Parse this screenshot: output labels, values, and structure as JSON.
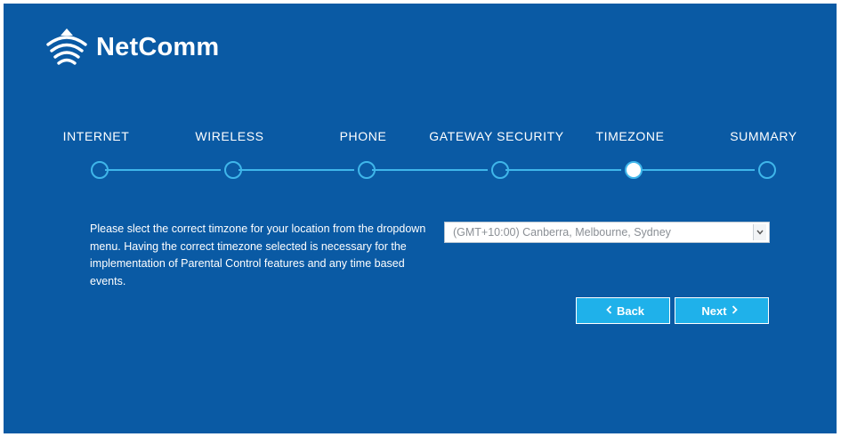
{
  "brand": {
    "name": "NetComm"
  },
  "wizard": {
    "steps": [
      {
        "label": "INTERNET",
        "active": false
      },
      {
        "label": "WIRELESS",
        "active": false
      },
      {
        "label": "PHONE",
        "active": false
      },
      {
        "label": "GATEWAY SECURITY",
        "active": false
      },
      {
        "label": "TIMEZONE",
        "active": true
      },
      {
        "label": "SUMMARY",
        "active": false
      }
    ]
  },
  "main": {
    "description": "Please slect the correct timzone for your location from the dropdown menu. Having the correct timezone selected is necessary for the implementation of Parental Control features and any time based events.",
    "timezone_select": {
      "selected": "(GMT+10:00) Canberra, Melbourne, Sydney"
    },
    "back_label": "Back",
    "next_label": "Next"
  },
  "colors": {
    "background": "#0a5aa4",
    "accent": "#3fb6ea",
    "button": "#1fb1ea"
  },
  "icons": [
    "wifi-logo-icon",
    "chevron-down-icon",
    "chevron-left-icon",
    "chevron-right-icon"
  ]
}
